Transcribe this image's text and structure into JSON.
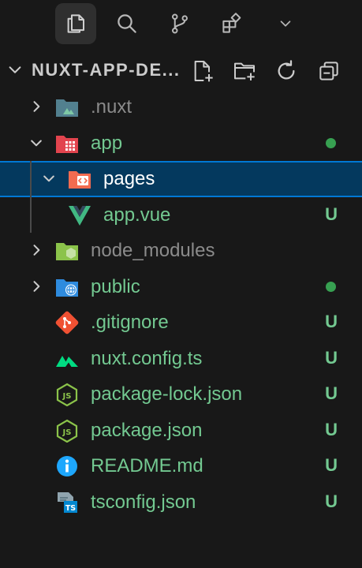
{
  "colors": {
    "background": "#181818",
    "selection": "#04395e",
    "selection_border": "#0078d4",
    "git_untracked": "#73c991",
    "git_dot": "#37a051",
    "muted_text": "#8b8b8b"
  },
  "viewbar": [
    {
      "icon": "files-icon",
      "active": true
    },
    {
      "icon": "search-icon",
      "active": false
    },
    {
      "icon": "source-control-icon",
      "active": false
    },
    {
      "icon": "extensions-icon",
      "active": false
    },
    {
      "icon": "chevron-down-icon",
      "active": false
    }
  ],
  "explorer": {
    "title": "NUXT-APP-DE...",
    "actions": [
      "new-file-icon",
      "new-folder-icon",
      "refresh-icon",
      "collapse-all-icon"
    ],
    "items": [
      {
        "name": ".nuxt",
        "kind": "folder",
        "expanded": false,
        "icon": "nuxt-folder-icon",
        "status": "",
        "dot": false,
        "muted": true
      },
      {
        "name": "app",
        "kind": "folder",
        "expanded": true,
        "icon": "app-folder-icon",
        "status": "",
        "dot": true,
        "muted": false
      },
      {
        "name": "pages",
        "kind": "folder",
        "expanded": true,
        "icon": "pages-folder-icon",
        "status": "",
        "dot": false,
        "muted": false,
        "selected": true
      },
      {
        "name": "app.vue",
        "kind": "file",
        "icon": "vue-icon",
        "status": "U",
        "dot": false,
        "muted": false
      },
      {
        "name": "node_modules",
        "kind": "folder",
        "expanded": false,
        "icon": "node-modules-folder-icon",
        "status": "",
        "dot": false,
        "muted": true
      },
      {
        "name": "public",
        "kind": "folder",
        "expanded": false,
        "icon": "public-folder-icon",
        "status": "",
        "dot": true,
        "muted": false
      },
      {
        "name": ".gitignore",
        "kind": "file",
        "icon": "git-icon",
        "status": "U",
        "dot": false,
        "muted": false
      },
      {
        "name": "nuxt.config.ts",
        "kind": "file",
        "icon": "nuxt-icon",
        "status": "U",
        "dot": false,
        "muted": false
      },
      {
        "name": "package-lock.json",
        "kind": "file",
        "icon": "nodejs-icon",
        "status": "U",
        "dot": false,
        "muted": false
      },
      {
        "name": "package.json",
        "kind": "file",
        "icon": "nodejs-icon",
        "status": "U",
        "dot": false,
        "muted": false
      },
      {
        "name": "README.md",
        "kind": "file",
        "icon": "info-icon",
        "status": "U",
        "dot": false,
        "muted": false
      },
      {
        "name": "tsconfig.json",
        "kind": "file",
        "icon": "tsconfig-icon",
        "status": "U",
        "dot": false,
        "muted": false
      }
    ]
  }
}
